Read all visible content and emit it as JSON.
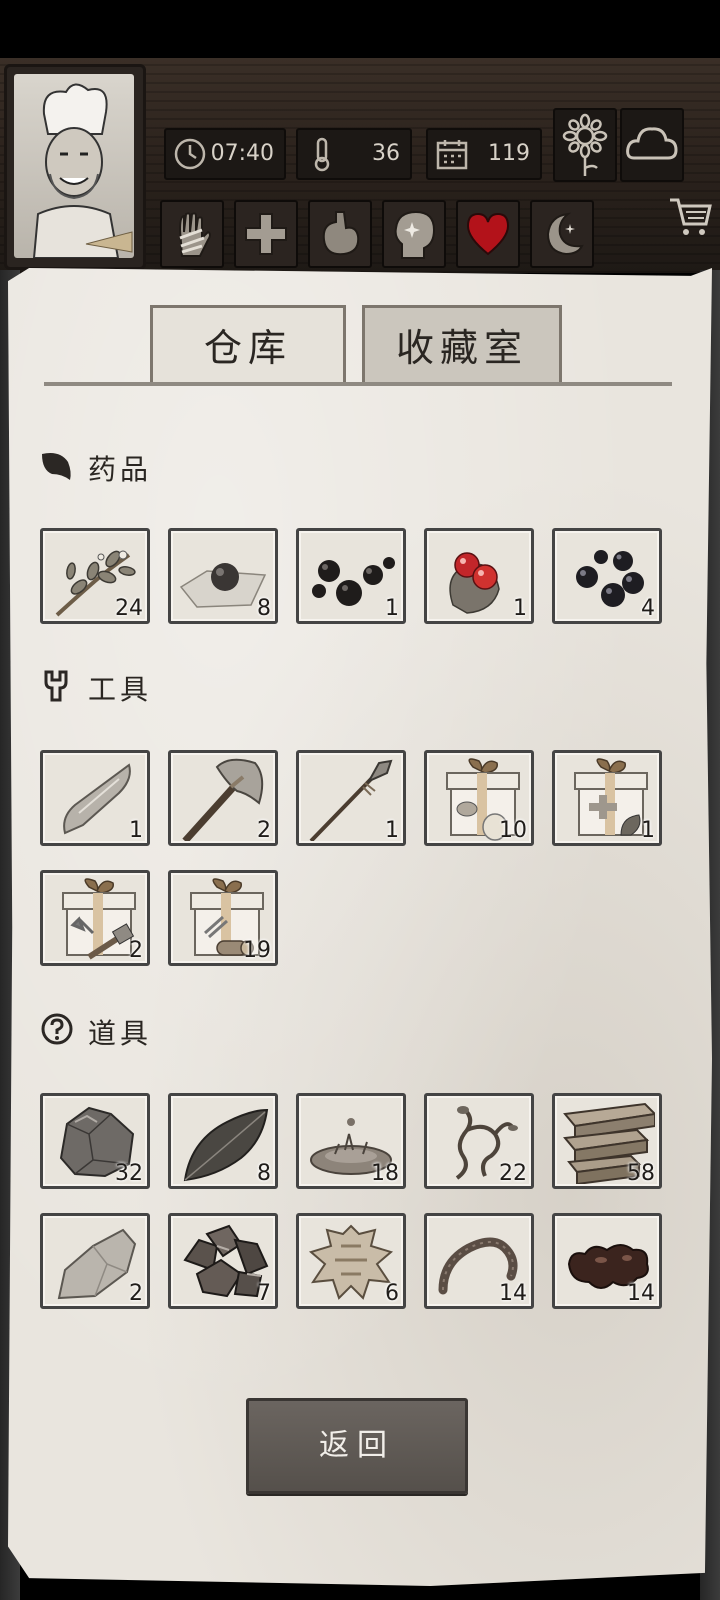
{
  "hud": {
    "time": "07:40",
    "temperature": "36",
    "day": "119"
  },
  "tabs": {
    "warehouse": "仓库",
    "collection": "收藏室"
  },
  "sections": [
    {
      "title": "药品",
      "items": [
        {
          "name": "herb-branch",
          "qty": "24"
        },
        {
          "name": "black-pill-on-paper",
          "qty": "8"
        },
        {
          "name": "black-pills",
          "qty": "1"
        },
        {
          "name": "red-berries",
          "qty": "1"
        },
        {
          "name": "black-berries",
          "qty": "4"
        }
      ]
    },
    {
      "title": "工具",
      "items": [
        {
          "name": "stone-knife",
          "qty": "1"
        },
        {
          "name": "stone-axe",
          "qty": "2"
        },
        {
          "name": "spear",
          "qty": "1"
        },
        {
          "name": "gift-box-food",
          "qty": "10"
        },
        {
          "name": "gift-box-herb",
          "qty": "1"
        },
        {
          "name": "gift-box-hammer",
          "qty": "2"
        },
        {
          "name": "gift-box-wood",
          "qty": "19"
        }
      ]
    },
    {
      "title": "道具",
      "items": [
        {
          "name": "stone",
          "qty": "32"
        },
        {
          "name": "leaf",
          "qty": "8"
        },
        {
          "name": "water-drop",
          "qty": "18"
        },
        {
          "name": "vine",
          "qty": "22"
        },
        {
          "name": "wood-planks",
          "qty": "58"
        },
        {
          "name": "flint",
          "qty": "2"
        },
        {
          "name": "ore",
          "qty": "7"
        },
        {
          "name": "animal-hide",
          "qty": "6"
        },
        {
          "name": "worm",
          "qty": "14"
        },
        {
          "name": "tar",
          "qty": "14"
        }
      ]
    }
  ],
  "back_button": "返回",
  "colors": {
    "paper": "#e9e5de",
    "wood": "#2c231d",
    "heart": "#b3121a",
    "button": "#5f5954"
  }
}
